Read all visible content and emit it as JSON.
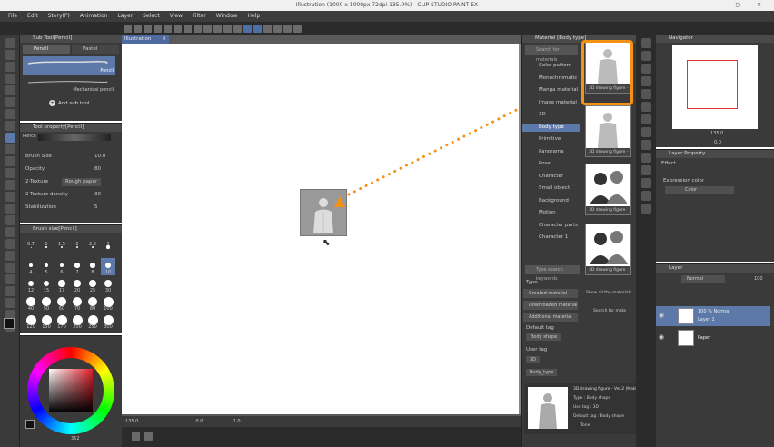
{
  "title_bar": {
    "title": "Illustration (1000 x 1000px 72dpi 135.0%) - CLIP STUDIO PAINT EX"
  },
  "menu": [
    "File",
    "Edit",
    "Story(P)",
    "Animation",
    "Layer",
    "Select",
    "View",
    "Filter",
    "Window",
    "Help"
  ],
  "doc_tab": "Illustration",
  "subtool": {
    "header": "Sub Tool[Pencil]",
    "tabs": [
      "Pencil",
      "Pastel"
    ],
    "items": [
      "Pencil",
      "Mechanical pencil"
    ],
    "add_label": "Add sub tool"
  },
  "tool_property": {
    "header": "Tool property[Pencil]",
    "name": "Pencil",
    "rows": [
      {
        "label": "Brush Size",
        "value": "10.0"
      },
      {
        "label": "Opacity",
        "value": "80"
      },
      {
        "label": "2-Texture",
        "value": "Rough paper"
      },
      {
        "label": "2-Texture density",
        "value": "30"
      },
      {
        "label": "Stabilization",
        "value": "5"
      }
    ]
  },
  "brush_size": {
    "header": "Brush size[Pencil]",
    "sizes": [
      "0.7",
      "1",
      "1.5",
      "2",
      "2.5",
      "3",
      "4",
      "5",
      "6",
      "7",
      "8",
      "10",
      "12",
      "15",
      "17",
      "20",
      "25",
      "30",
      "40",
      "50",
      "60",
      "70",
      "80",
      "100",
      "120",
      "150",
      "170",
      "200",
      "250",
      "300"
    ],
    "selected": "10"
  },
  "color_wheel": {
    "hue_color": "#e0202a",
    "value": "352"
  },
  "material": {
    "header": "Material [Body type]",
    "search_placeholder": "Search for materials",
    "tree": [
      {
        "label": "Color pattern"
      },
      {
        "label": "Monochromatic"
      },
      {
        "label": "Manga material"
      },
      {
        "label": "Image material"
      },
      {
        "label": "3D"
      },
      {
        "label": "Body type",
        "selected": true
      },
      {
        "label": "Primitive"
      },
      {
        "label": "Panorama"
      },
      {
        "label": "Pose"
      },
      {
        "label": "Character"
      },
      {
        "label": "Small object"
      },
      {
        "label": "Background"
      },
      {
        "label": "Motion"
      },
      {
        "label": "Character parts"
      },
      {
        "label": "Character 1"
      }
    ],
    "tag_search_placeholder": "Type search keywords",
    "type_header": "Type",
    "type_items": [
      "Created material",
      "Downloaded material",
      "Additional material"
    ],
    "default_tag_header": "Default tag",
    "default_tag": "Body shape",
    "user_tag_header": "User tag",
    "user_tags": [
      "3D",
      "Body_type"
    ],
    "show_all": "Show all the materials",
    "search_for": "Search for mate",
    "thumbs": [
      "3D drawing figure - Ver.2",
      "3D drawing figure - Ver.2",
      "3D drawing figure",
      "3D drawing figure"
    ],
    "detail": {
      "name": "3D drawing figure - Ver.2 (Male)",
      "type": "Type : Body shape",
      "usage": "Use tag : 3D",
      "default_tag": "Default tag : Body shape",
      "tone": "Tone"
    }
  },
  "navigator": {
    "header": "Navigator",
    "zoom": "135.0",
    "angle": "0.0"
  },
  "layer_property": {
    "header": "Layer Property",
    "effect": "Effect",
    "expression_label": "Expression color",
    "expression_value": "Color"
  },
  "layers": {
    "header": "Layer",
    "blend": "Normal",
    "opacity": "100",
    "items": [
      {
        "percent": "100 % Normal",
        "name": "Layer 1",
        "selected": true
      },
      {
        "percent": "",
        "name": "Paper",
        "selected": false
      }
    ]
  },
  "status": {
    "zoom": "135.0",
    "angle": "0.0",
    "coord": "1.0"
  },
  "accent": "#f39214"
}
